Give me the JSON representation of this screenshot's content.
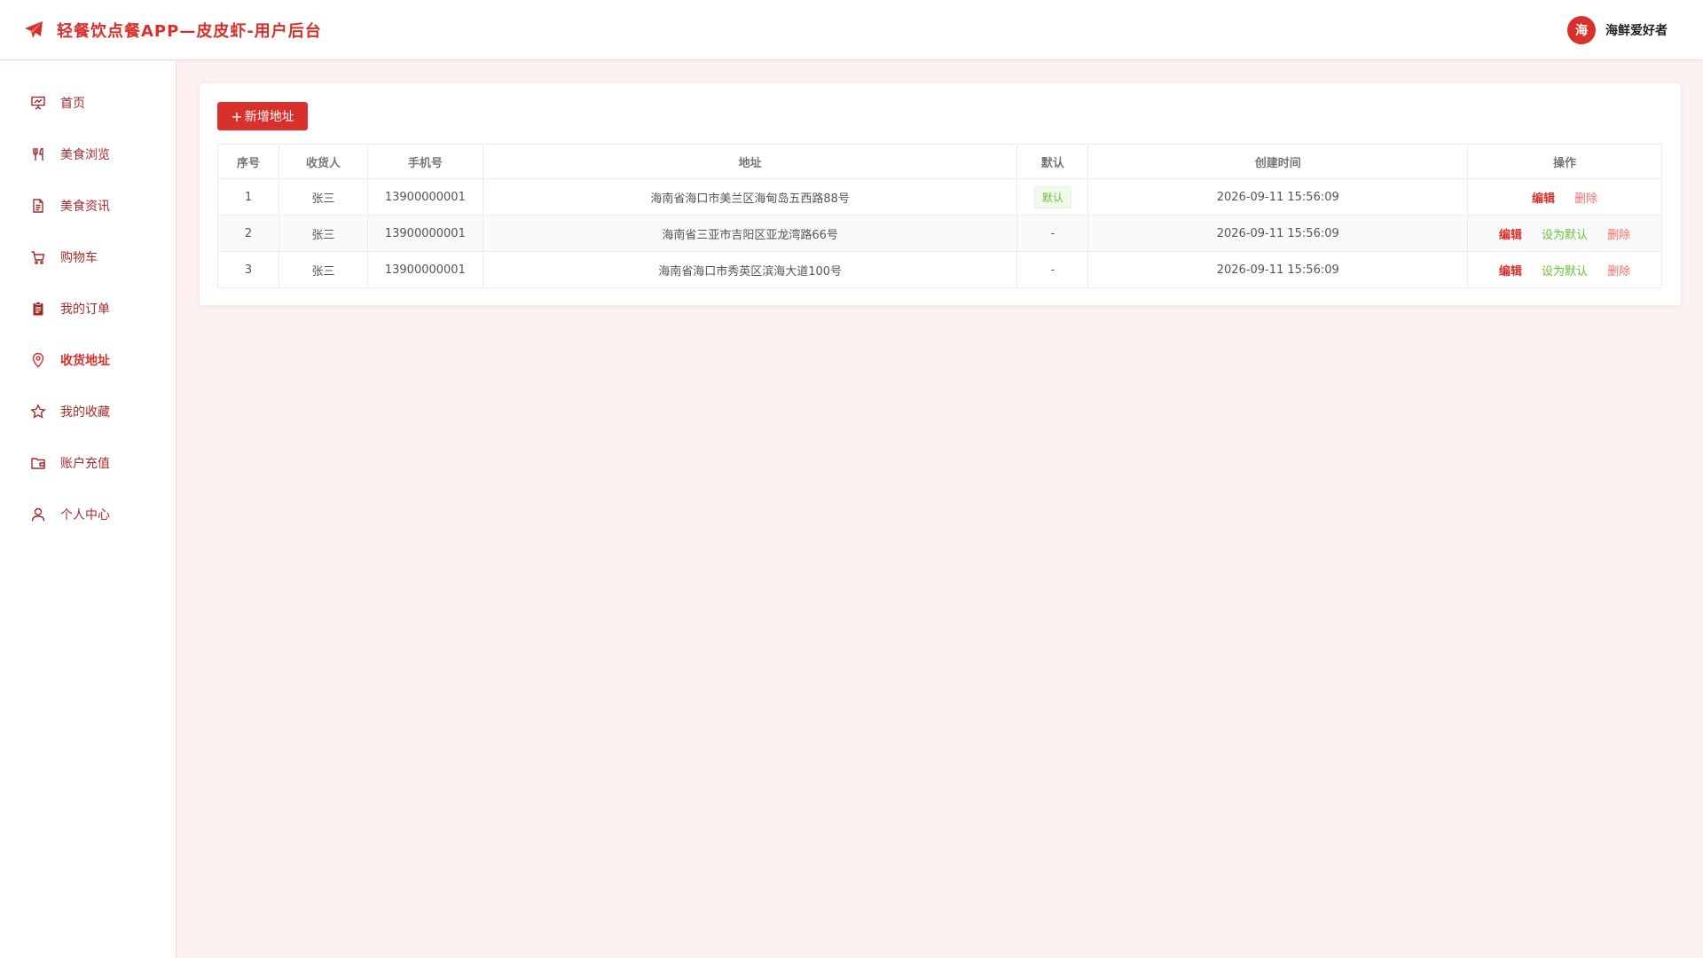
{
  "header": {
    "title": "轻餐饮点餐APP—皮皮虾-用户后台",
    "avatar_text": "海",
    "username": "海鲜爱好者"
  },
  "sidebar": {
    "items": [
      {
        "label": "首页",
        "icon": "presentation-icon"
      },
      {
        "label": "美食浏览",
        "icon": "utensils-icon"
      },
      {
        "label": "美食资讯",
        "icon": "document-icon"
      },
      {
        "label": "购物车",
        "icon": "cart-icon"
      },
      {
        "label": "我的订单",
        "icon": "clipboard-icon"
      },
      {
        "label": "收货地址",
        "icon": "location-pin-icon",
        "active": true
      },
      {
        "label": "我的收藏",
        "icon": "star-icon"
      },
      {
        "label": "账户充值",
        "icon": "wallet-icon"
      },
      {
        "label": "个人中心",
        "icon": "user-icon"
      }
    ]
  },
  "main": {
    "add_button": "新增地址",
    "table": {
      "columns": [
        "序号",
        "收货人",
        "手机号",
        "地址",
        "默认",
        "创建时间",
        "操作"
      ],
      "rows": [
        {
          "index": "1",
          "name": "张三",
          "phone": "13900000001",
          "address": "海南省海口市美兰区海甸岛五西路88号",
          "default": "默认",
          "created": "2026-09-11 15:56:09"
        },
        {
          "index": "2",
          "name": "张三",
          "phone": "13900000001",
          "address": "海南省三亚市吉阳区亚龙湾路66号",
          "default": "-",
          "created": "2026-09-11 15:56:09"
        },
        {
          "index": "3",
          "name": "张三",
          "phone": "13900000001",
          "address": "海南省海口市秀英区滨海大道100号",
          "default": "-",
          "created": "2026-09-11 15:56:09"
        }
      ],
      "actions": {
        "edit": "编辑",
        "set_default": "设为默认",
        "delete": "删除"
      }
    }
  },
  "colors": {
    "accent": "#d9302c",
    "success": "#67c23a",
    "danger": "#f56c6c",
    "background": "#fdf1f1"
  }
}
